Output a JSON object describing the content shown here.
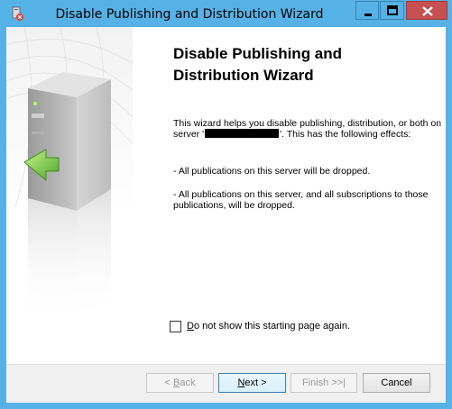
{
  "window": {
    "title": "Disable Publishing and Distribution Wizard",
    "icon": "wizard-app-icon",
    "caption_buttons": [
      "minimize-icon",
      "maximize-icon",
      "close-icon"
    ]
  },
  "side_art": {
    "icon": "server-tower-illustration"
  },
  "content": {
    "heading": "Disable Publishing and Distribution Wizard",
    "intro_before": "This wizard helps you disable publishing, distribution, or both on server '",
    "intro_after": "'. This has the following effects:",
    "effect_1": "- All publications on this server will be dropped.",
    "effect_2": "- All publications on this server, and all subscriptions to those publications, will be dropped."
  },
  "checkbox": {
    "label_accel": "D",
    "label_rest": "o not show this starting page again.",
    "checked": false
  },
  "buttons": {
    "back_prefix": "< ",
    "back_accel": "B",
    "back_rest": "ack",
    "next_accel": "N",
    "next_rest": "ext >",
    "finish_label": "Finish >>|",
    "cancel_label": "Cancel"
  }
}
